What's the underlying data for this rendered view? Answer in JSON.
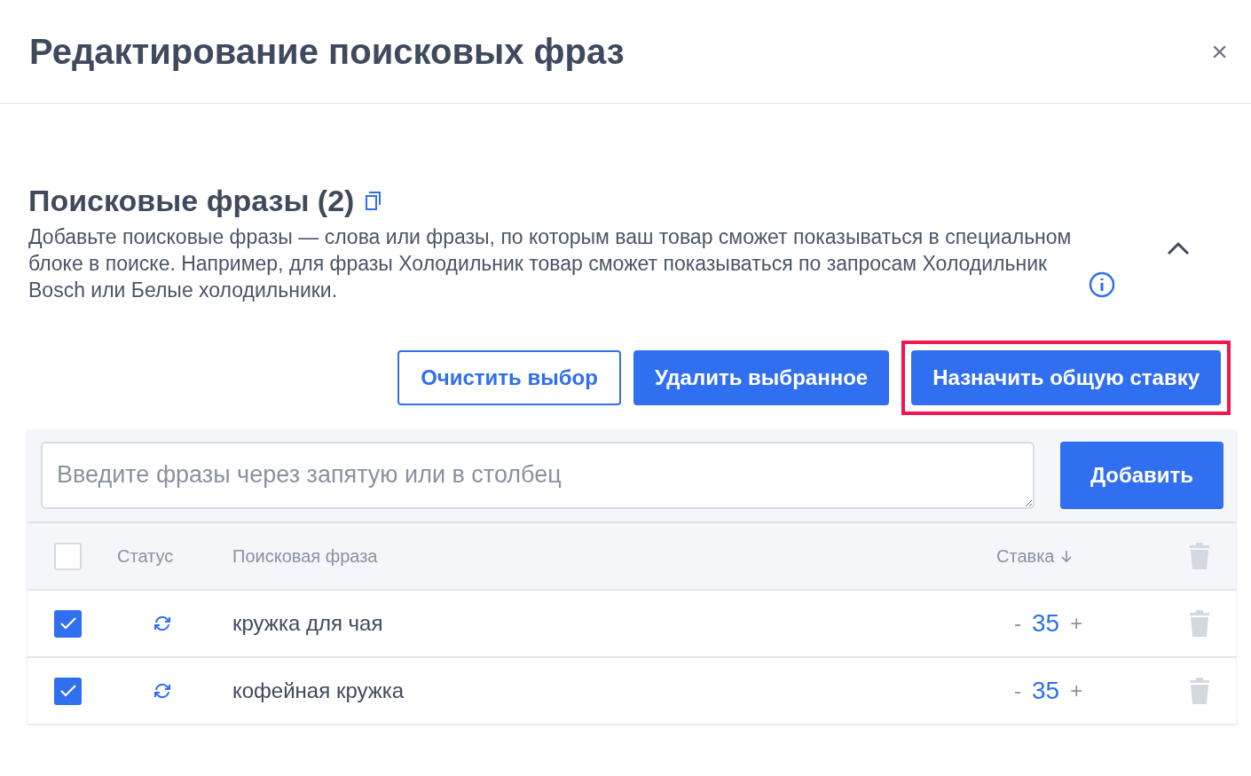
{
  "dialog": {
    "title": "Редактирование поисковых фраз",
    "close": "×"
  },
  "section": {
    "title": "Поисковые фразы (2)",
    "expanded": true,
    "description": "Добавьте поисковые фразы — слова или фразы, по которым ваш товар сможет показываться в специальном блоке в поиске. Например, для фразы Холодильник товар сможет показываться по запросам Холодильник Bosch или Белые холодильники."
  },
  "actions": [
    {
      "label": "Очистить выбор",
      "kind": "outline",
      "highlighted": false
    },
    {
      "label": "Удалить выбранное",
      "kind": "filled",
      "highlighted": false
    },
    {
      "label": "Назначить общую ставку",
      "kind": "filled",
      "highlighted": true
    }
  ],
  "input": {
    "placeholder": "Введите фразы через запятую или в столбец",
    "button": "Добавить"
  },
  "table": {
    "select_all": {
      "checked": false
    },
    "columns": [
      "Статус",
      "Поисковая фраза",
      "Ставка"
    ],
    "rows": [
      {
        "checked": true,
        "phrase": "кружка для чая",
        "minus": "-",
        "bid": "35",
        "plus": "+"
      },
      {
        "checked": true,
        "phrase": "кофейная кружка",
        "minus": "-",
        "bid": "35",
        "plus": "+"
      }
    ]
  }
}
